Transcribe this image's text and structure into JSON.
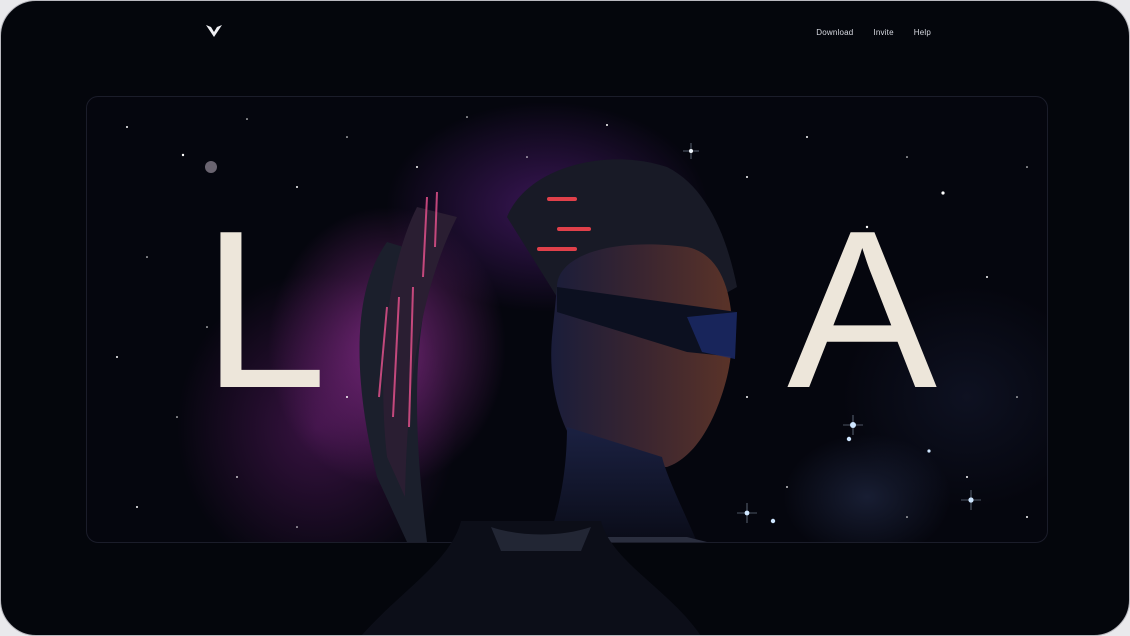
{
  "nav": {
    "links": [
      "Download",
      "Invite",
      "Help"
    ]
  },
  "hero": {
    "title_letters": [
      "L",
      "A"
    ]
  },
  "icons": {
    "logo": "chevron-v-logo-icon"
  },
  "colors": {
    "page_bg": "#04060c",
    "title_text": "#ede6da",
    "nebula_accent": "#be3cbe",
    "star_glow": "#7fb8ff"
  }
}
